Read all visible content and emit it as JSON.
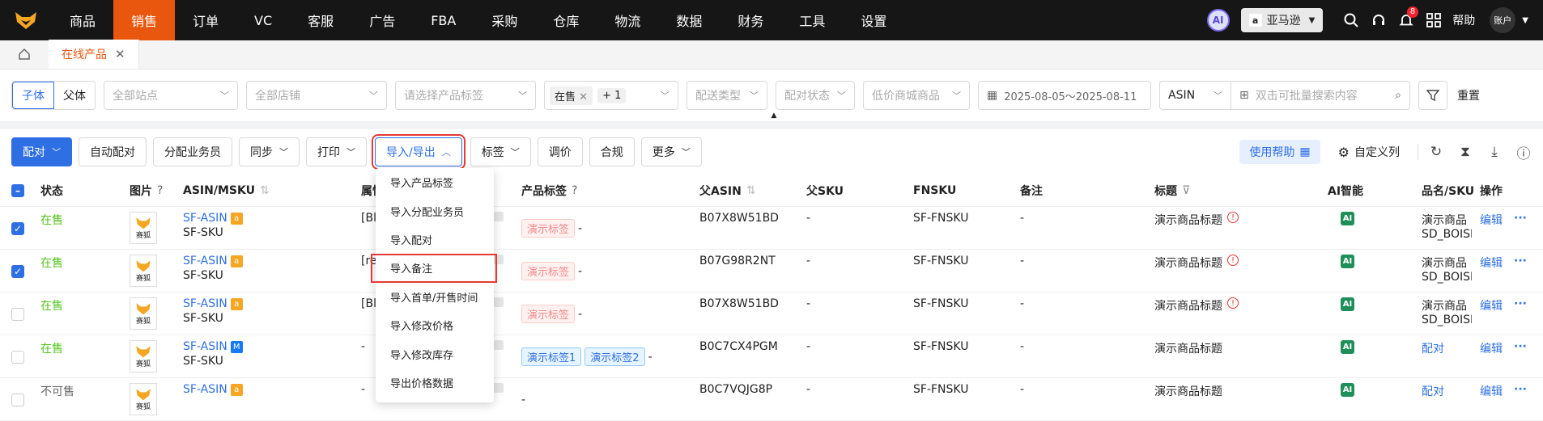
{
  "nav": {
    "items": [
      "商品",
      "销售",
      "订单",
      "VC",
      "客服",
      "广告",
      "FBA",
      "采购",
      "仓库",
      "物流",
      "数据",
      "财务",
      "工具",
      "设置"
    ],
    "active_index": 1,
    "ai_label": "AI",
    "platform": "亚马逊",
    "notification_count": "8",
    "help": "帮助",
    "account": "账户"
  },
  "tabs": {
    "page_tab": "在线产品"
  },
  "filters": {
    "seg_child": "子体",
    "seg_parent": "父体",
    "site_placeholder": "全部站点",
    "store_placeholder": "全部店铺",
    "tag_placeholder": "请选择产品标签",
    "status_chip": "在售",
    "status_more": "+ 1",
    "delivery_placeholder": "配送类型",
    "pair_placeholder": "配对状态",
    "lowprice_placeholder": "低价商城商品",
    "date_range": "2025-08-05～2025-08-11",
    "search_type": "ASIN",
    "search_placeholder": "双击可批量搜索内容",
    "reset": "重置"
  },
  "toolbar": {
    "pair": "配对",
    "auto_pair": "自动配对",
    "assign_staff": "分配业务员",
    "sync": "同步",
    "print": "打印",
    "import_export": "导入/导出",
    "tag": "标签",
    "price": "调价",
    "compliance": "合规",
    "more": "更多",
    "use_help": "使用帮助",
    "custom_cols": "自定义列"
  },
  "dropdown": {
    "items": [
      "导入产品标签",
      "导入分配业务员",
      "导入配对",
      "导入备注",
      "导入首单/开售时间",
      "导入修改价格",
      "导入修改库存",
      "导出价格数据"
    ],
    "highlight_index": 3
  },
  "table": {
    "headers": {
      "status": "状态",
      "image": "图片",
      "asin_msku": "ASIN/MSKU",
      "attr": "属性",
      "product_tag": "产品标签",
      "parent_asin": "父ASIN",
      "parent_sku": "父SKU",
      "fnsku": "FNSKU",
      "remark": "备注",
      "title": "标题",
      "ai": "AI智能",
      "name_sku": "品名/SKU",
      "ops": "操作"
    },
    "thumb_label": "赛狐",
    "edit": "编辑",
    "pair_link": "配对",
    "rows": [
      {
        "checked": true,
        "status": "在售",
        "status_on": true,
        "asin": "SF-ASIN",
        "badge": "a",
        "sku": "SF-SKU",
        "attr": "[Bl",
        "tags": [
          "演示标签"
        ],
        "tag_type": "pink",
        "parent_asin": "B07X8W51BD",
        "parent_sku": "-",
        "fnsku": "SF-FNSKU",
        "remark": "-",
        "title": "演示商品标题",
        "warn": true,
        "ai": "AI",
        "name1": "演示商品",
        "name2": "SD_BOISI",
        "pair": ""
      },
      {
        "checked": true,
        "status": "在售",
        "status_on": true,
        "asin": "SF-ASIN",
        "badge": "a",
        "sku": "SF-SKU",
        "attr": "[re",
        "tags": [
          "演示标签"
        ],
        "tag_type": "pink",
        "parent_asin": "B07G98R2NT",
        "parent_sku": "-",
        "fnsku": "SF-FNSKU",
        "remark": "-",
        "title": "演示商品标题",
        "warn": true,
        "ai": "AI",
        "name1": "演示商品",
        "name2": "SD_BOISI",
        "pair": ""
      },
      {
        "checked": false,
        "status": "在售",
        "status_on": true,
        "asin": "SF-ASIN",
        "badge": "a",
        "sku": "SF-SKU",
        "attr": "[Bl",
        "tags": [
          "演示标签"
        ],
        "tag_type": "pink",
        "parent_asin": "B07X8W51BD",
        "parent_sku": "-",
        "fnsku": "SF-FNSKU",
        "remark": "-",
        "title": "演示商品标题",
        "warn": true,
        "ai": "AI",
        "name1": "演示商品",
        "name2": "SD_BOISI",
        "pair": ""
      },
      {
        "checked": false,
        "status": "在售",
        "status_on": true,
        "asin": "SF-ASIN",
        "badge": "M",
        "sku": "SF-SKU",
        "attr": "-",
        "tags": [
          "演示标签1",
          "演示标签2"
        ],
        "tag_type": "blue",
        "parent_asin": "B0C7CX4PGM",
        "parent_sku": "-",
        "fnsku": "SF-FNSKU",
        "remark": "-",
        "title": "演示商品标题",
        "warn": false,
        "ai": "AI",
        "name1": "",
        "name2": "",
        "pair": "配对"
      },
      {
        "checked": false,
        "status": "不可售",
        "status_on": false,
        "asin": "SF-ASIN",
        "badge": "a",
        "sku": "",
        "attr": "-",
        "tags": [],
        "tag_type": "",
        "parent_asin": "B0C7VQJG8P",
        "parent_sku": "-",
        "fnsku": "SF-FNSKU",
        "remark": "-",
        "title": "演示商品标题",
        "warn": false,
        "ai": "AI",
        "name1": "",
        "name2": "",
        "pair": "配对"
      }
    ]
  },
  "colors": {
    "accent": "#2f6fe4",
    "nav_active": "#e8570d",
    "nav_bg": "#161616",
    "highlight": "#e53935"
  }
}
